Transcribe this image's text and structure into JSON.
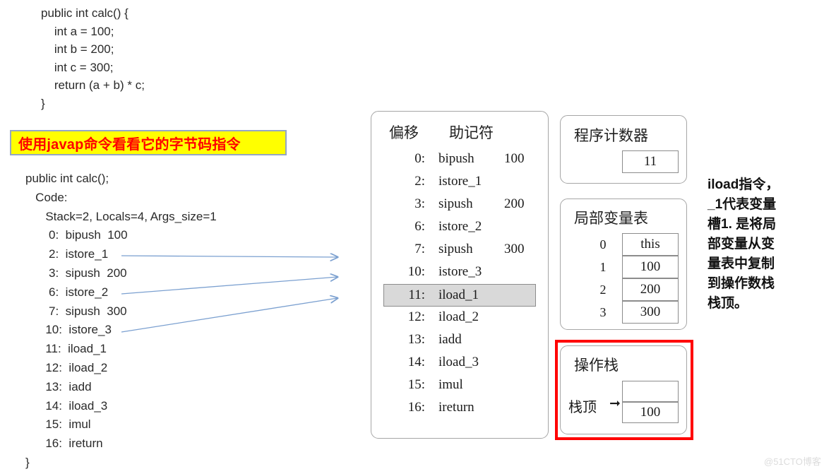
{
  "java_source": {
    "lines": [
      "public int calc() {",
      "    int a = 100;",
      "    int b = 200;",
      "    int c = 300;",
      "    return (a + b) * c;",
      "}"
    ]
  },
  "javap_banner": {
    "text": "使用javap命令看看它的字节码指令",
    "background": "#ffff00",
    "text_color": "#ff0000",
    "border_color": "#94a6c4"
  },
  "javap_output": {
    "lines": [
      "public int calc();",
      "   Code:",
      "      Stack=2, Locals=4, Args_size=1",
      "       0:  bipush  100",
      "       2:  istore_1",
      "       3:  sipush  200",
      "       6:  istore_2",
      "       7:  sipush  300",
      "      10:  istore_3",
      "      11:  iload_1",
      "      12:  iload_2",
      "      13:  iadd",
      "      14:  iload_3",
      "      15:  imul",
      "      16:  ireturn",
      "}"
    ]
  },
  "bytecode_panel": {
    "header": {
      "offset": "偏移",
      "mnemonic": "助记符"
    },
    "highlight_color": "#d9d9d9",
    "rows": [
      {
        "offset": "0:",
        "mnemonic": "bipush",
        "operand": "100",
        "highlighted": false
      },
      {
        "offset": "2:",
        "mnemonic": "istore_1",
        "operand": "",
        "highlighted": false
      },
      {
        "offset": "3:",
        "mnemonic": "sipush",
        "operand": "200",
        "highlighted": false
      },
      {
        "offset": "6:",
        "mnemonic": "istore_2",
        "operand": "",
        "highlighted": false
      },
      {
        "offset": "7:",
        "mnemonic": "sipush",
        "operand": "300",
        "highlighted": false
      },
      {
        "offset": "10:",
        "mnemonic": "istore_3",
        "operand": "",
        "highlighted": false
      },
      {
        "offset": "11:",
        "mnemonic": "iload_1",
        "operand": "",
        "highlighted": true
      },
      {
        "offset": "12:",
        "mnemonic": "iload_2",
        "operand": "",
        "highlighted": false
      },
      {
        "offset": "13:",
        "mnemonic": "iadd",
        "operand": "",
        "highlighted": false
      },
      {
        "offset": "14:",
        "mnemonic": "iload_3",
        "operand": "",
        "highlighted": false
      },
      {
        "offset": "15:",
        "mnemonic": "imul",
        "operand": "",
        "highlighted": false
      },
      {
        "offset": "16:",
        "mnemonic": "ireturn",
        "operand": "",
        "highlighted": false
      }
    ]
  },
  "program_counter": {
    "title": "程序计数器",
    "value": "11"
  },
  "local_variable_table": {
    "title": "局部变量表",
    "rows": [
      {
        "index": "0",
        "value": "this"
      },
      {
        "index": "1",
        "value": "100"
      },
      {
        "index": "2",
        "value": "200"
      },
      {
        "index": "3",
        "value": "300"
      }
    ]
  },
  "operand_stack": {
    "title": "操作栈",
    "top_label": "栈顶",
    "arrow_glyph": "➞",
    "highlight_color": "#ff0000",
    "cells": [
      {
        "value": ""
      },
      {
        "value": "100"
      }
    ]
  },
  "note": {
    "text": "iload指令，_1代表变量槽1. 是将局部变量从变量表中复制到操作数栈栈顶。"
  },
  "watermark": {
    "text": "@51CTO博客"
  },
  "arrows": {
    "color": "#7ba0d0",
    "connectors": [
      {
        "from_label": "istore_1",
        "to_label": "bytecode-panel"
      },
      {
        "from_label": "istore_2",
        "to_label": "bytecode-panel"
      },
      {
        "from_label": "istore_3",
        "to_label": "bytecode-panel"
      }
    ]
  }
}
